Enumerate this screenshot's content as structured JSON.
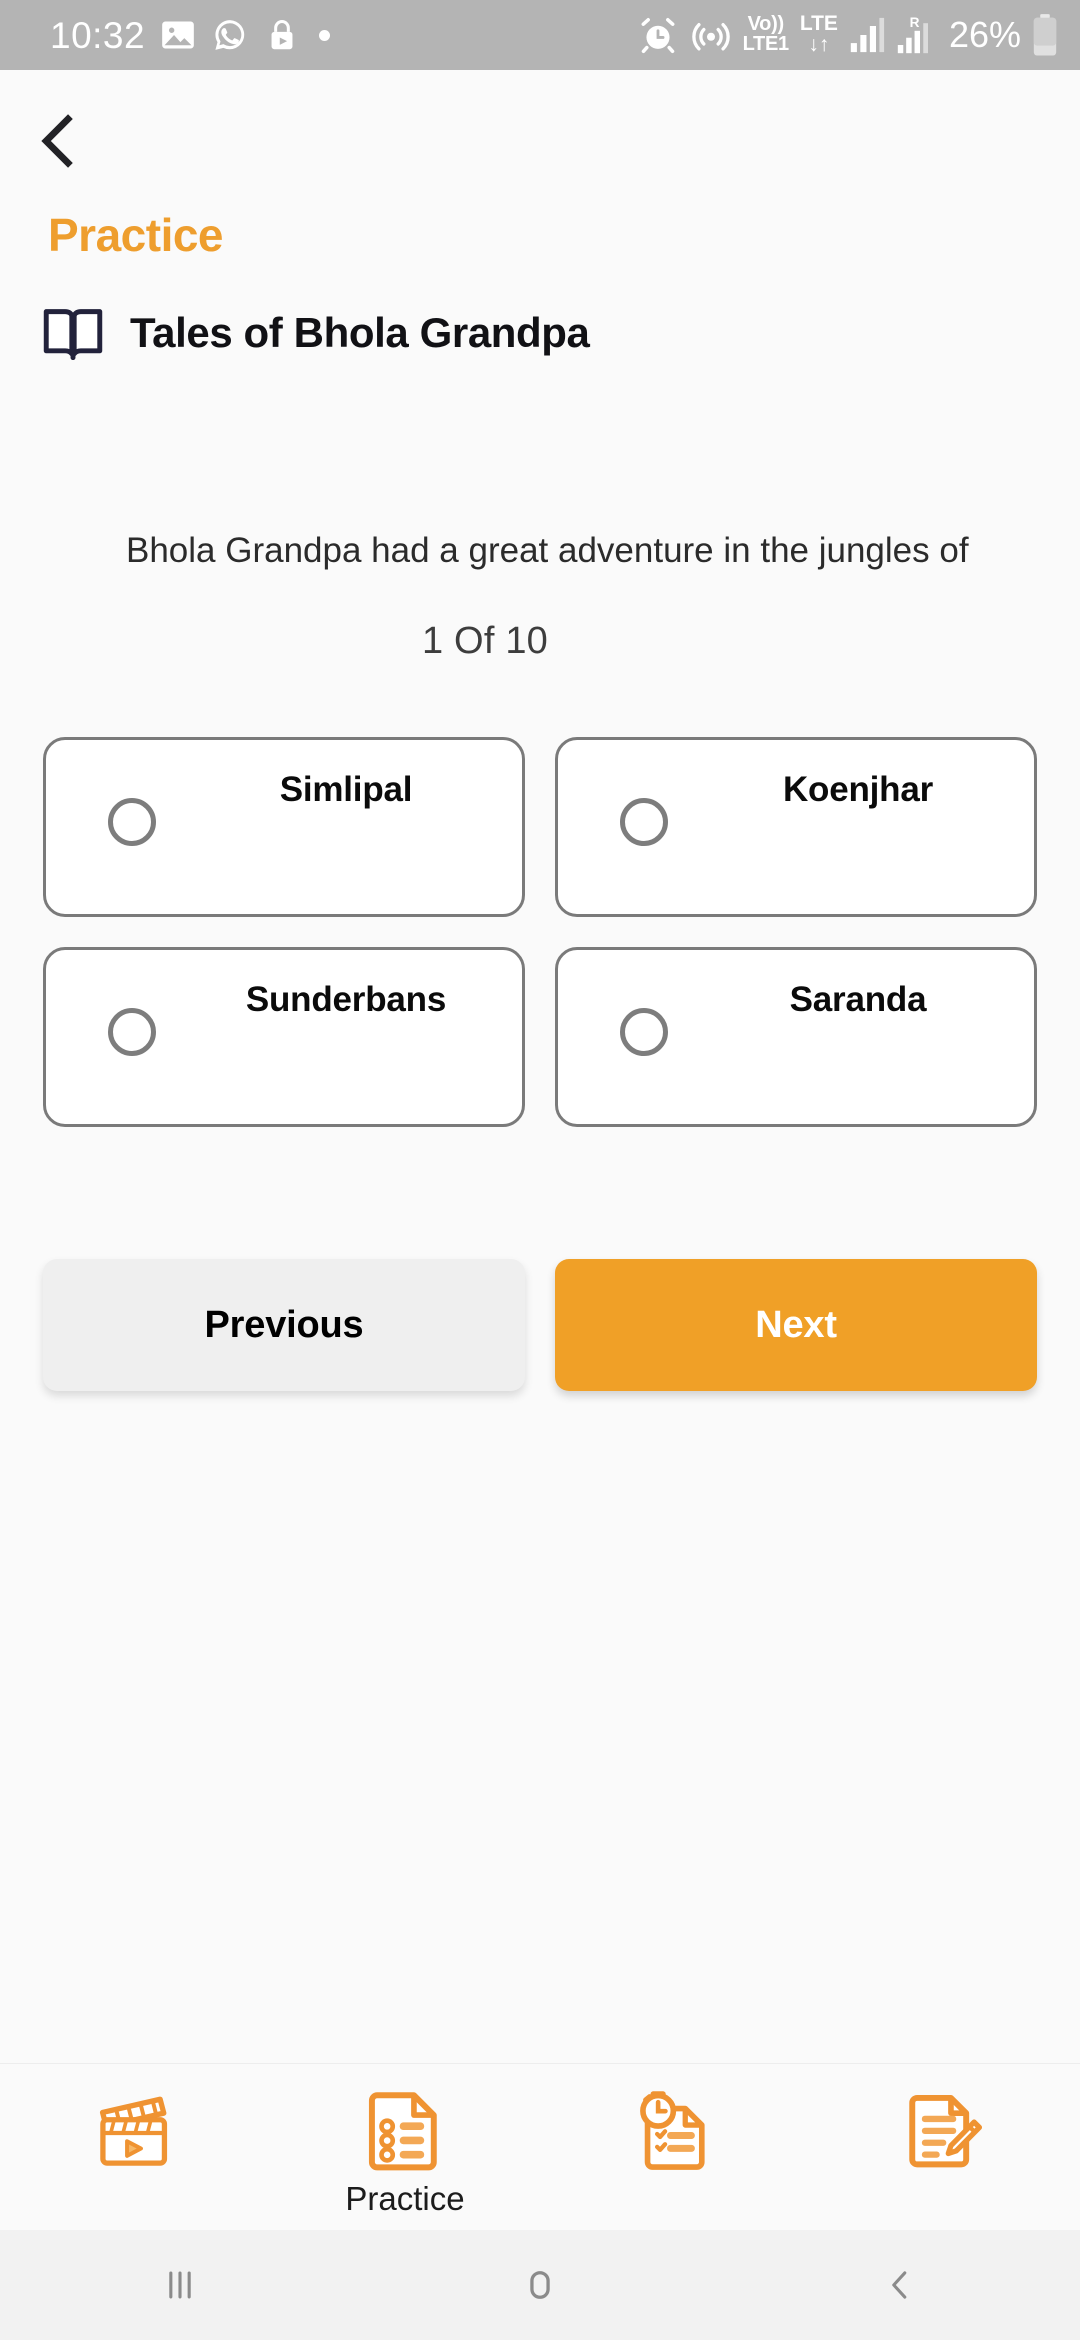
{
  "status_bar": {
    "clock": "10:32",
    "left_icons": [
      "gallery-icon",
      "whatsapp-icon",
      "play-store-lock-icon",
      "dot-indicator"
    ],
    "alarm_icon": "alarm-icon",
    "hotspot_icon": "hotspot-icon",
    "volte_line1": "Vo))",
    "volte_line2": "LTE1",
    "lte_label": "LTE",
    "data_arrows": "↓↑",
    "roaming_label": "R",
    "battery_text": "26%",
    "battery_level_percent": 26
  },
  "header": {
    "back_icon": "chevron-left-icon",
    "section_title": "Practice",
    "book_icon": "open-book-icon",
    "lesson_title": "Tales of Bhola Grandpa",
    "accent_color": "#ee9e2e"
  },
  "question": {
    "text": "Bhola Grandpa had a great adventure in the jungles of",
    "counter": "1 Of 10",
    "current_index": 1,
    "total": 10,
    "options": [
      {
        "label": "Simlipal",
        "selected": false
      },
      {
        "label": "Koenjhar",
        "selected": false
      },
      {
        "label": "Sunderbans",
        "selected": false
      },
      {
        "label": "Saranda",
        "selected": false
      }
    ]
  },
  "navigation": {
    "previous_label": "Previous",
    "next_label": "Next",
    "previous_bg": "#efefef",
    "next_bg": "#f0a027"
  },
  "tab_bar": {
    "items": [
      {
        "icon": "video-clapperboard-icon",
        "label": "",
        "active": false
      },
      {
        "icon": "practice-document-icon",
        "label": "Practice",
        "active": true
      },
      {
        "icon": "timed-test-clipboard-icon",
        "label": "",
        "active": false
      },
      {
        "icon": "notes-edit-icon",
        "label": "",
        "active": false
      }
    ],
    "icon_color": "#ef9332"
  },
  "system_nav": {
    "recents_icon": "recents-icon",
    "home_icon": "home-icon",
    "back_icon": "back-icon"
  }
}
